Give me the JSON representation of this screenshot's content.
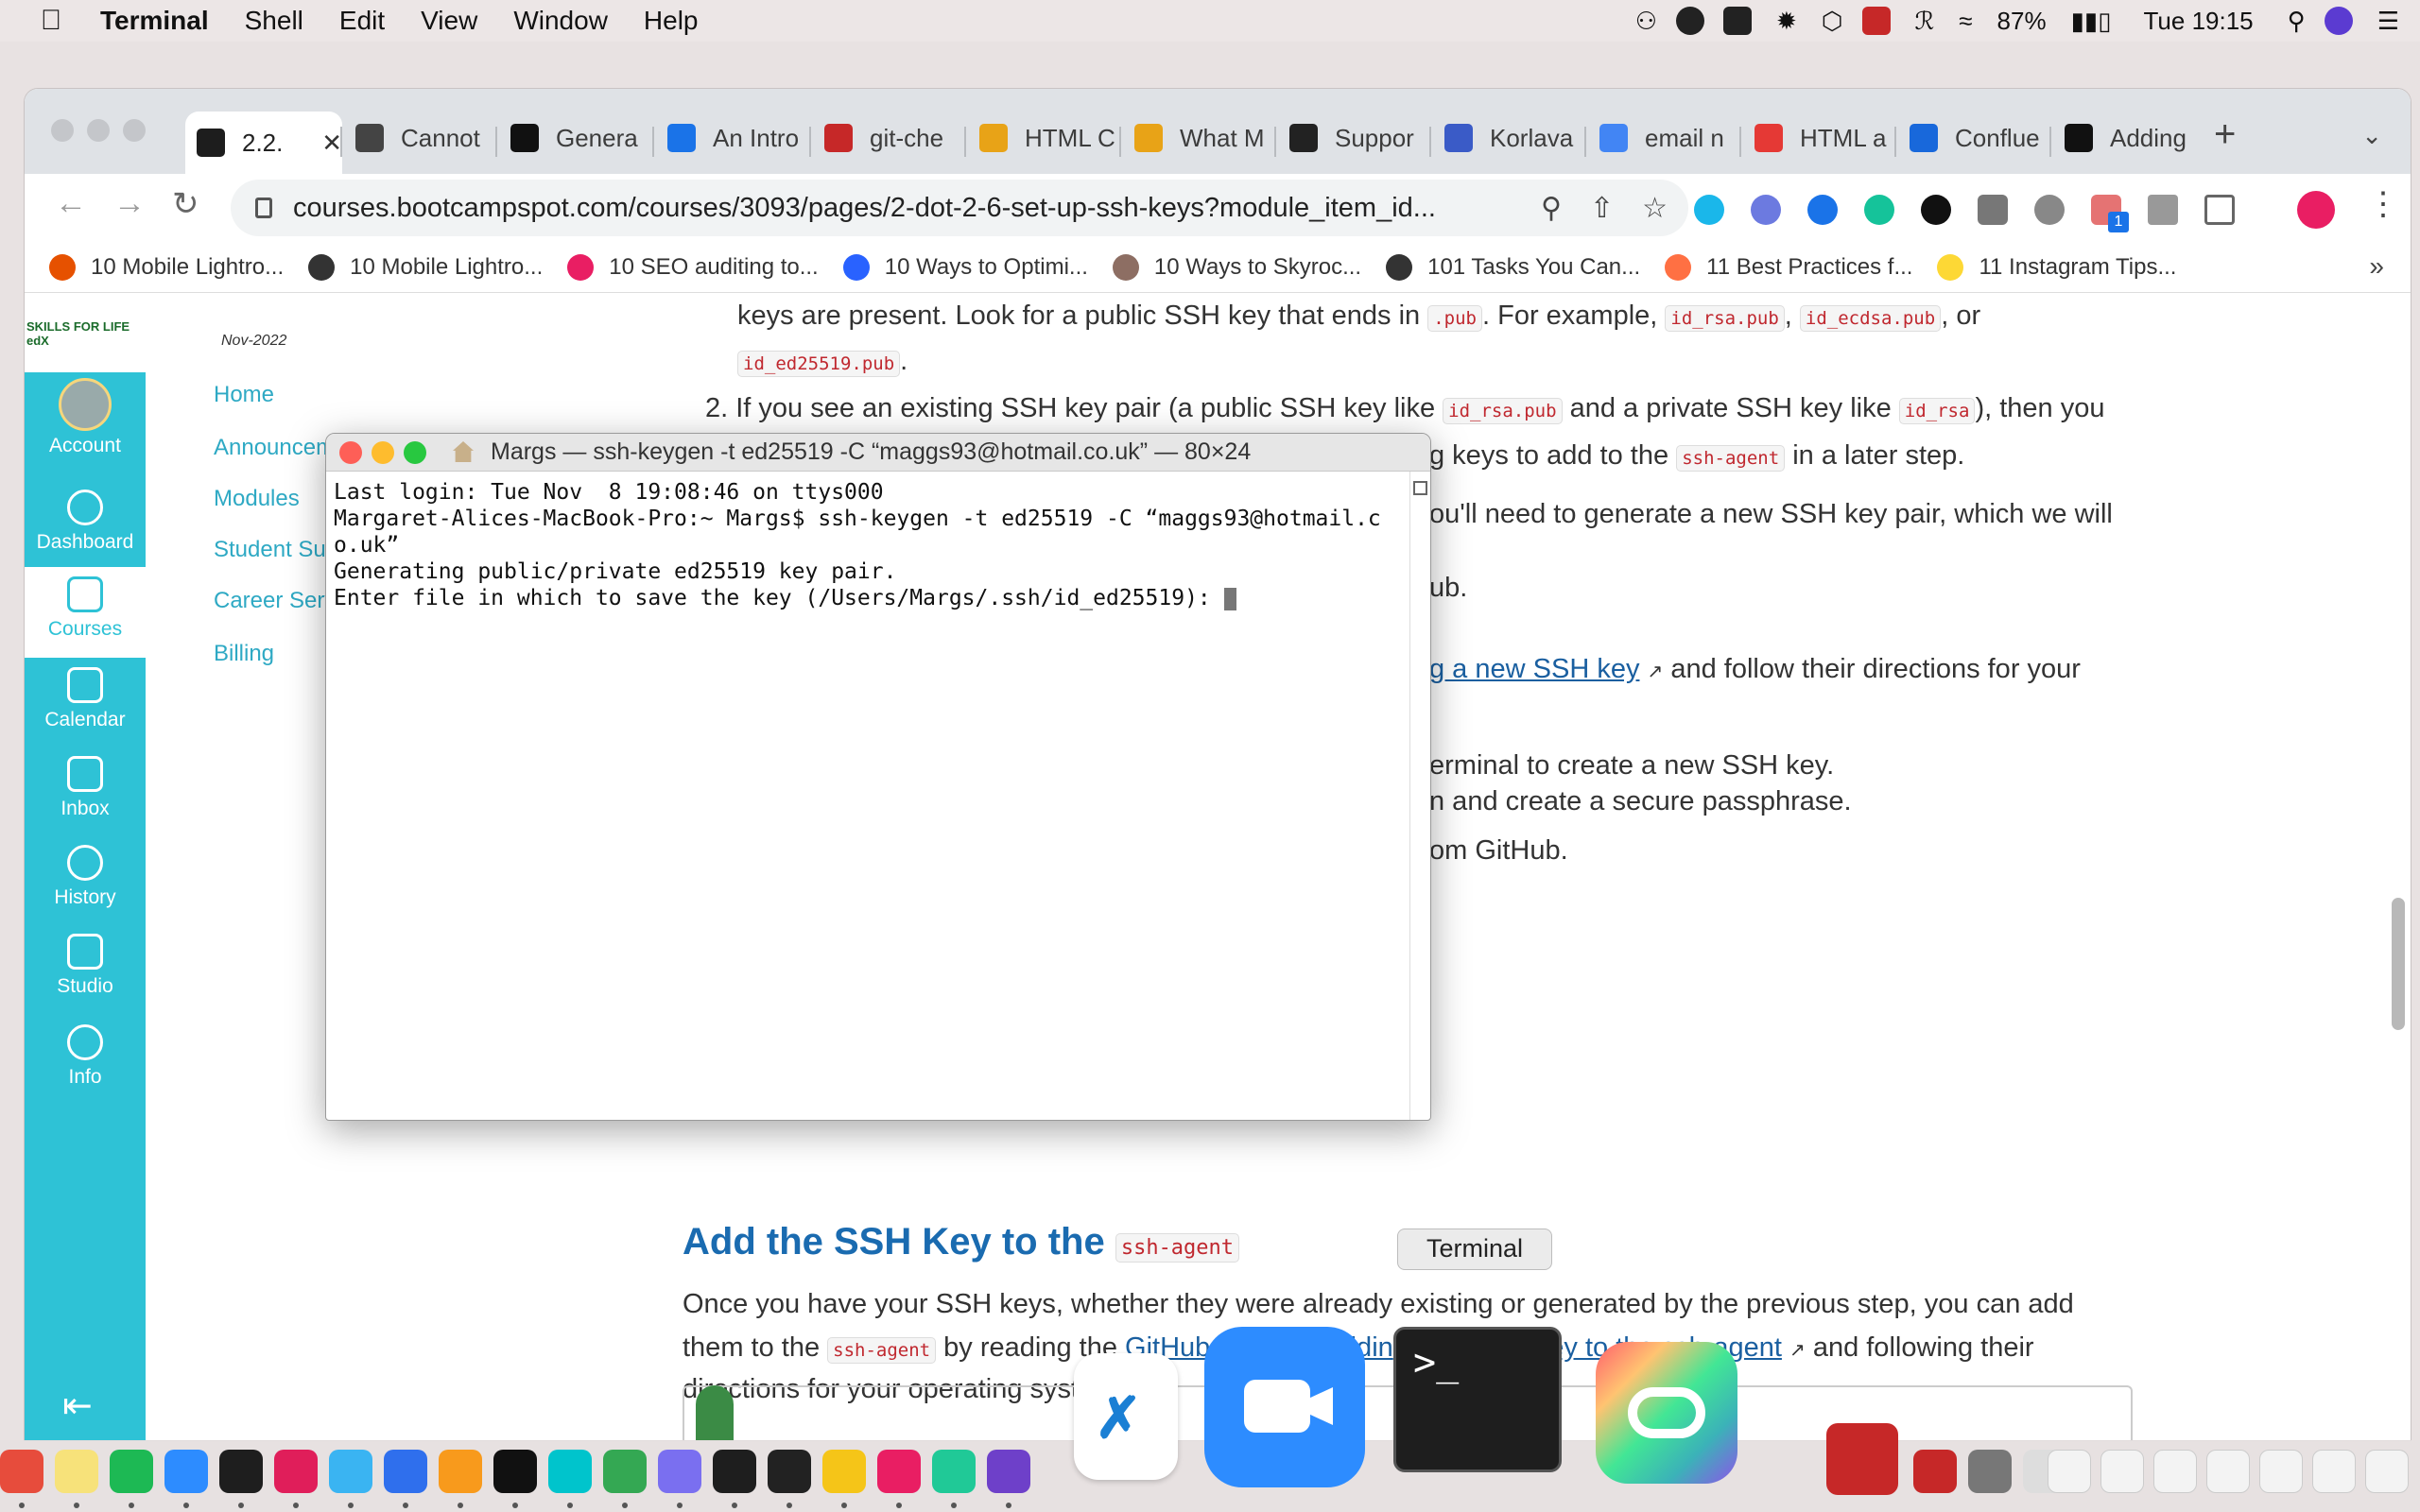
{
  "menubar": {
    "app": "Terminal",
    "items": [
      "Shell",
      "Edit",
      "View",
      "Window",
      "Help"
    ],
    "battery": "87%",
    "clock": "Tue 19:15"
  },
  "browser": {
    "tabs": [
      {
        "label": "2.2.",
        "favicon": "edx-icon",
        "color": "#1d1d1d"
      },
      {
        "label": "Cannot",
        "favicon": "grid-icon",
        "color": "#444444"
      },
      {
        "label": "Genera",
        "favicon": "github-icon",
        "color": "#111111"
      },
      {
        "label": "An Intro",
        "favicon": "play-icon",
        "color": "#1a73e8"
      },
      {
        "label": "git-che",
        "favicon": "pdf-icon",
        "color": "#c62828"
      },
      {
        "label": "HTML C",
        "favicon": "fs-icon",
        "color": "#e8a317"
      },
      {
        "label": "What M",
        "favicon": "fs-icon",
        "color": "#e8a317"
      },
      {
        "label": "Suppor",
        "favicon": "b-icon",
        "color": "#222222"
      },
      {
        "label": "Korlava",
        "favicon": "pen-icon",
        "color": "#3a5bc7"
      },
      {
        "label": "email n",
        "favicon": "google-icon",
        "color": "#4285f4"
      },
      {
        "label": "HTML a",
        "favicon": "a-icon",
        "color": "#e53935"
      },
      {
        "label": "Conflue",
        "favicon": "confluence-icon",
        "color": "#1868db"
      },
      {
        "label": "Adding",
        "favicon": "github-icon",
        "color": "#111111"
      }
    ],
    "url": "courses.bootcampspot.com/courses/3093/pages/2-dot-2-6-set-up-ssh-keys?module_item_id...",
    "bookmarks": [
      "10 Mobile Lightro...",
      "10 Mobile Lightro...",
      "10 SEO auditing to...",
      "10 Ways to Optimi...",
      "10 Ways to Skyroc...",
      "101 Tasks You Can...",
      "11 Best Practices f...",
      "11 Instagram Tips..."
    ],
    "bookmark_colors": [
      "#e65100",
      "#333333",
      "#e91e63",
      "#2962ff",
      "#8d6e63",
      "#333333",
      "#ff7043",
      "#fdd835"
    ],
    "ext_badge": "1"
  },
  "gnav": {
    "logo_text": "SKILLS FOR LIFE edX",
    "account": "Account",
    "items": [
      "Dashboard",
      "Courses",
      "Calendar",
      "Inbox",
      "History",
      "Studio",
      "Info"
    ]
  },
  "course_nav": {
    "term": "Nov-2022",
    "links": [
      "Home",
      "Announcements",
      "Modules",
      "Student Support",
      "Career Services",
      "Billing"
    ]
  },
  "content": {
    "line1a": "keys are present. Look for a public SSH key that ends in",
    "code_pub": ".pub",
    "line1b": ". For example,",
    "code_rsa_pub": "id_rsa.pub",
    "comma": ",",
    "code_ecdsa_pub": "id_ecdsa.pub",
    "line1c": ", or",
    "code_ed_pub": "id_ed25519.pub",
    "period": ".",
    "line2a": "2. If you see an existing SSH key pair (a public SSH key like",
    "code_rsa_pub2": "id_rsa.pub",
    "line2b": "and a private SSH key like",
    "code_rsa": "id_rsa",
    "line2c": "), then you",
    "line3a": "g keys to add to the",
    "code_agent1": "ssh-agent",
    "line3b": "in a later step.",
    "line4": "ou'll need to generate a new SSH key pair, which we will",
    "line5": "ub.",
    "link1": "g a new SSH key",
    "line6": "and follow their directions for your",
    "line7": "erminal to create a new SSH key.",
    "line8": "n and create a secure passphrase.",
    "line9": "om GitHub.",
    "heading": "Add the SSH Key to the",
    "code_agent_h": "ssh-agent",
    "para1": "Once you have your SSH keys, whether they were already existing or generated by the previous step, you can add",
    "para2a": "them to the",
    "code_agent2": "ssh-agent",
    "para2b": "by reading the",
    "link2a": "GitHub Docs on addin",
    "link2b": "key to the ssh-agent",
    "para2c": "and following their",
    "para3": "directions for your operating system."
  },
  "terminal": {
    "title": "Margs — ssh-keygen -t ed25519 -C “maggs93@hotmail.co.uk” — 80×24",
    "lines": [
      "Last login: Tue Nov  8 19:08:46 on ttys000",
      "Margaret-Alices-MacBook-Pro:~ Margs$ ssh-keygen -t ed25519 -C “maggs93@hotmail.c",
      "o.uk”",
      "Generating public/private ed25519 key pair.",
      "Enter file in which to save the key (/Users/Margs/.ssh/id_ed25519): "
    ]
  },
  "tooltip": "Terminal",
  "dock": {
    "small_colors": [
      "#e74c3c",
      "#f7e27a",
      "#1db954",
      "#2d8cff",
      "#1e1e1e",
      "#e01e5a",
      "#3ab4f2",
      "#2f6fed",
      "#f89a1c",
      "#111111",
      "#00c4cc",
      "#34a853",
      "#7a6ff0",
      "#1e1e1e",
      "#222222",
      "#f5c518",
      "#e91e63",
      "#20c997",
      "#6e40c9"
    ],
    "right_colors": [
      "#c62828",
      "#777777",
      "#dddddd"
    ]
  }
}
